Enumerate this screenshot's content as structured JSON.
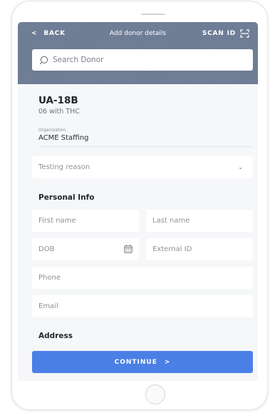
{
  "header": {
    "back_label": "BACK",
    "back_icon": "chevron-left-icon",
    "title": "Add donor details",
    "scan_label": "SCAN ID",
    "scan_icon": "scan-icon"
  },
  "search": {
    "placeholder": "Search Donor",
    "icon": "search-icon"
  },
  "test": {
    "code": "UA-18B",
    "description": "06 with THC"
  },
  "organization": {
    "label": "Organization",
    "value": "ACME Staffing"
  },
  "testing_reason": {
    "placeholder": "Testing reason",
    "icon": "chevron-down-icon"
  },
  "personal_info": {
    "title": "Personal Info",
    "first_name_placeholder": "First name",
    "last_name_placeholder": "Last name",
    "dob_placeholder": "DOB",
    "dob_icon": "calendar-icon",
    "external_id_placeholder": "External ID",
    "phone_placeholder": "Phone",
    "email_placeholder": "Email"
  },
  "address": {
    "title": "Address"
  },
  "footer": {
    "continue_label": "CONTINUE",
    "continue_icon": "chevron-right-icon"
  },
  "colors": {
    "header_bg": "#6d7b94",
    "primary": "#4a7fe6",
    "screen_bg": "#f6f7f9"
  }
}
